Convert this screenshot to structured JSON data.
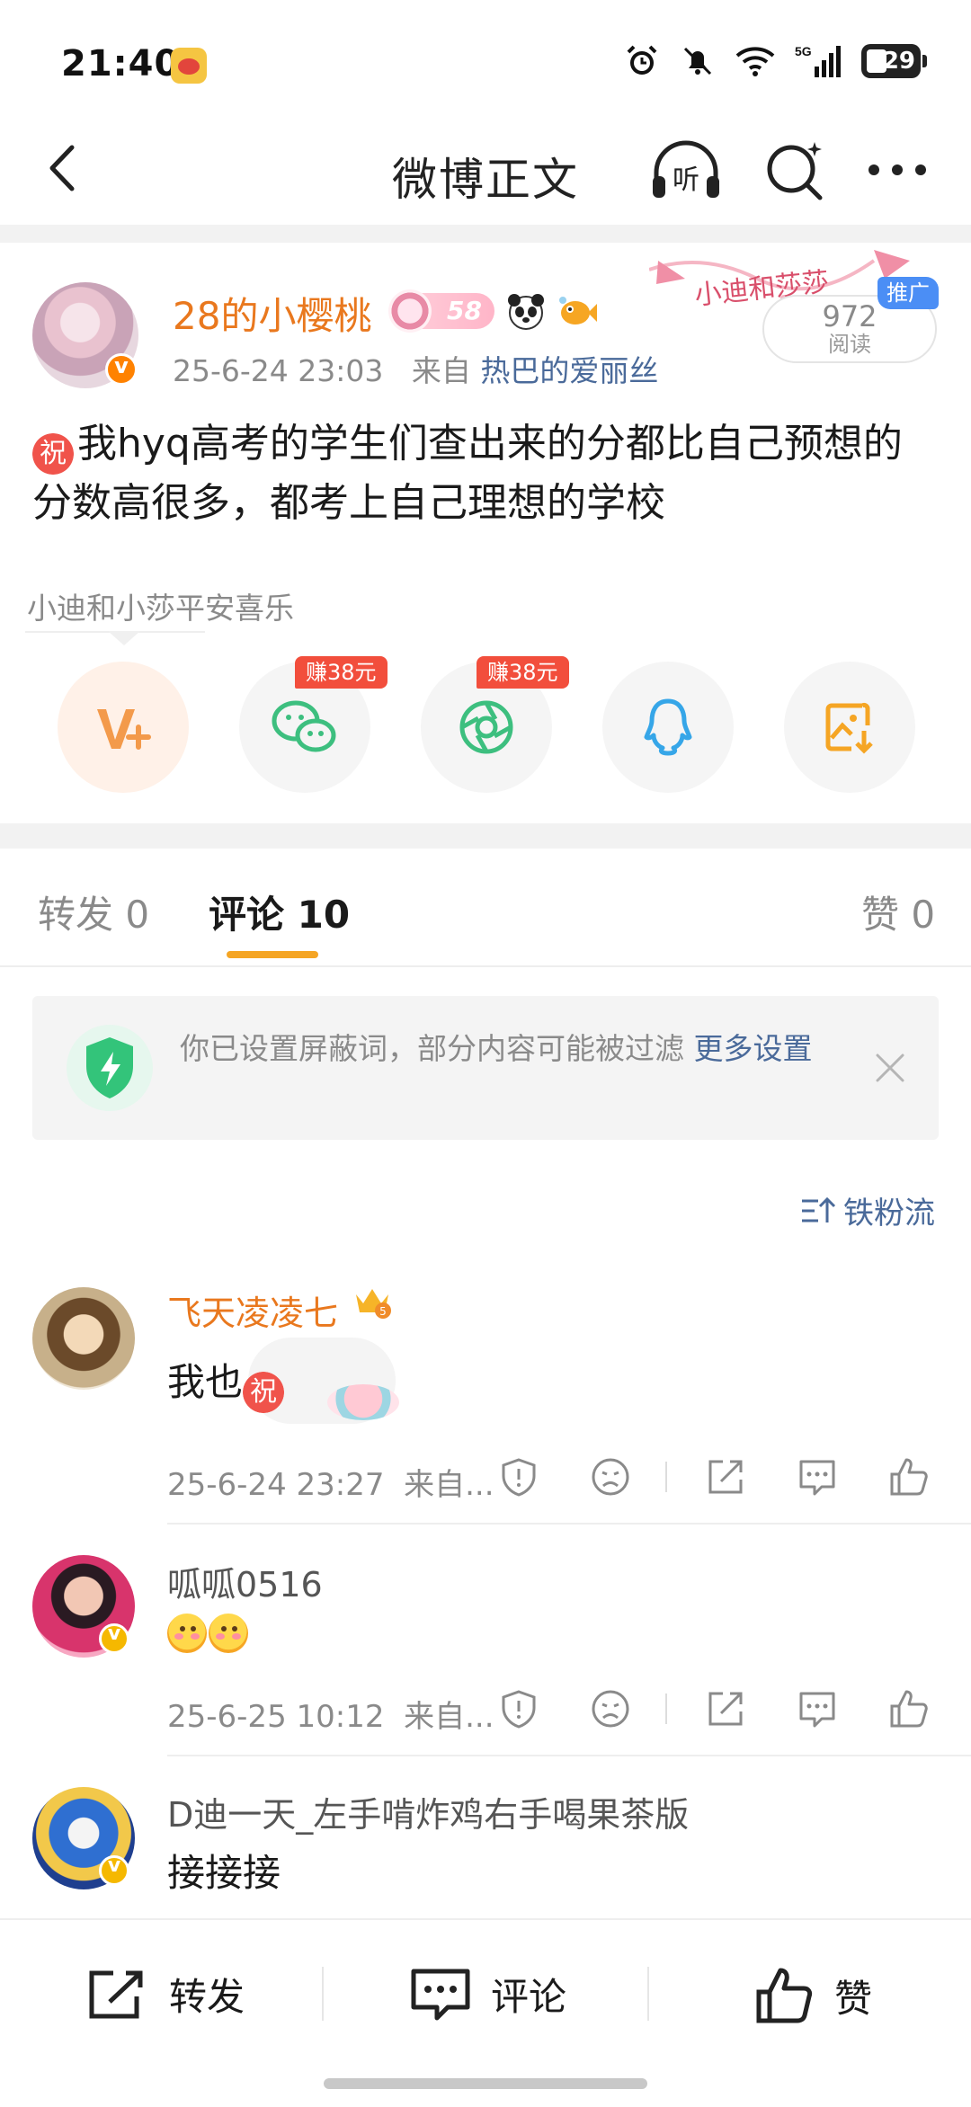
{
  "status_bar": {
    "time": "21:40",
    "network": "5G",
    "battery": "29"
  },
  "nav": {
    "title": "微博正文"
  },
  "post": {
    "author": "28的小樱桃",
    "vip_level": "58",
    "timestamp": "25-6-24 23:03",
    "source_prefix": "来自",
    "source": "热巴的爱丽丝",
    "reads": "972",
    "reads_label": "阅读",
    "promo_tag": "推广",
    "promo_deco_text": "小迪和莎莎",
    "text": "我hyq高考的学生们查出来的分都比自己预想的分数高很多，都考上自己理想的学校",
    "zhu_glyph": "祝",
    "group_label": "小迪和小莎平安喜乐"
  },
  "share": {
    "buttons": [
      {
        "name": "repost-to-weibo",
        "icon": "v-plus-icon"
      },
      {
        "name": "share-wechat",
        "icon": "wechat-icon",
        "badge": "赚38元"
      },
      {
        "name": "share-moments",
        "icon": "moments-icon",
        "badge": "赚38元"
      },
      {
        "name": "share-qq",
        "icon": "qq-icon"
      },
      {
        "name": "save-image",
        "icon": "image-download-icon"
      }
    ]
  },
  "tabs": {
    "repost": {
      "label": "转发",
      "count": "0"
    },
    "comment": {
      "label": "评论",
      "count": "10"
    },
    "like": {
      "label": "赞",
      "count": "0"
    }
  },
  "notice": {
    "text": "你已设置屏蔽词，部分内容可能被过滤",
    "link": "更多设置"
  },
  "sort": {
    "label": "铁粉流"
  },
  "comments": [
    {
      "name": "飞天凌凌七",
      "text": "我也",
      "zhu_glyph": "祝",
      "time": "25-6-24 23:27",
      "source": "来自..."
    },
    {
      "name": "呱呱0516",
      "text": "",
      "time": "25-6-25 10:12",
      "source": "来自..."
    },
    {
      "name": "D迪一天_左手啃炸鸡右手喝果茶版",
      "text": "接接接"
    }
  ],
  "bottom_bar": {
    "repost": "转发",
    "comment": "评论",
    "like": "赞"
  },
  "colors": {
    "accent": "#f5a524",
    "vip_name": "#e9781e",
    "link": "#4a6a9a",
    "badge_red": "#f24e3c"
  }
}
